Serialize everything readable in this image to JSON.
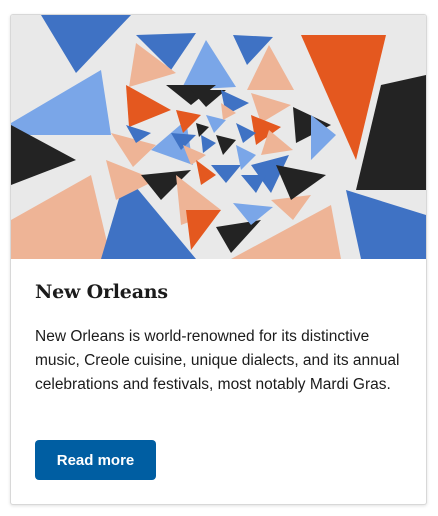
{
  "card": {
    "image_description_icon": "abstract-triangle-spiral-illustration",
    "title": "New Orleans",
    "description": "New Orleans is world-renowned for its distinctive music, Creole cuisine, unique dialects, and its annual celebrations and festivals, most notably Mardi Gras.",
    "button_label": "Read more"
  },
  "colors": {
    "accent": "#005ea2",
    "orange": "#e4581f",
    "peach": "#eeb496",
    "blue": "#3f72c4",
    "light_blue": "#7aa6e8",
    "dark": "#232323",
    "image_bg": "#e9e9e9"
  }
}
